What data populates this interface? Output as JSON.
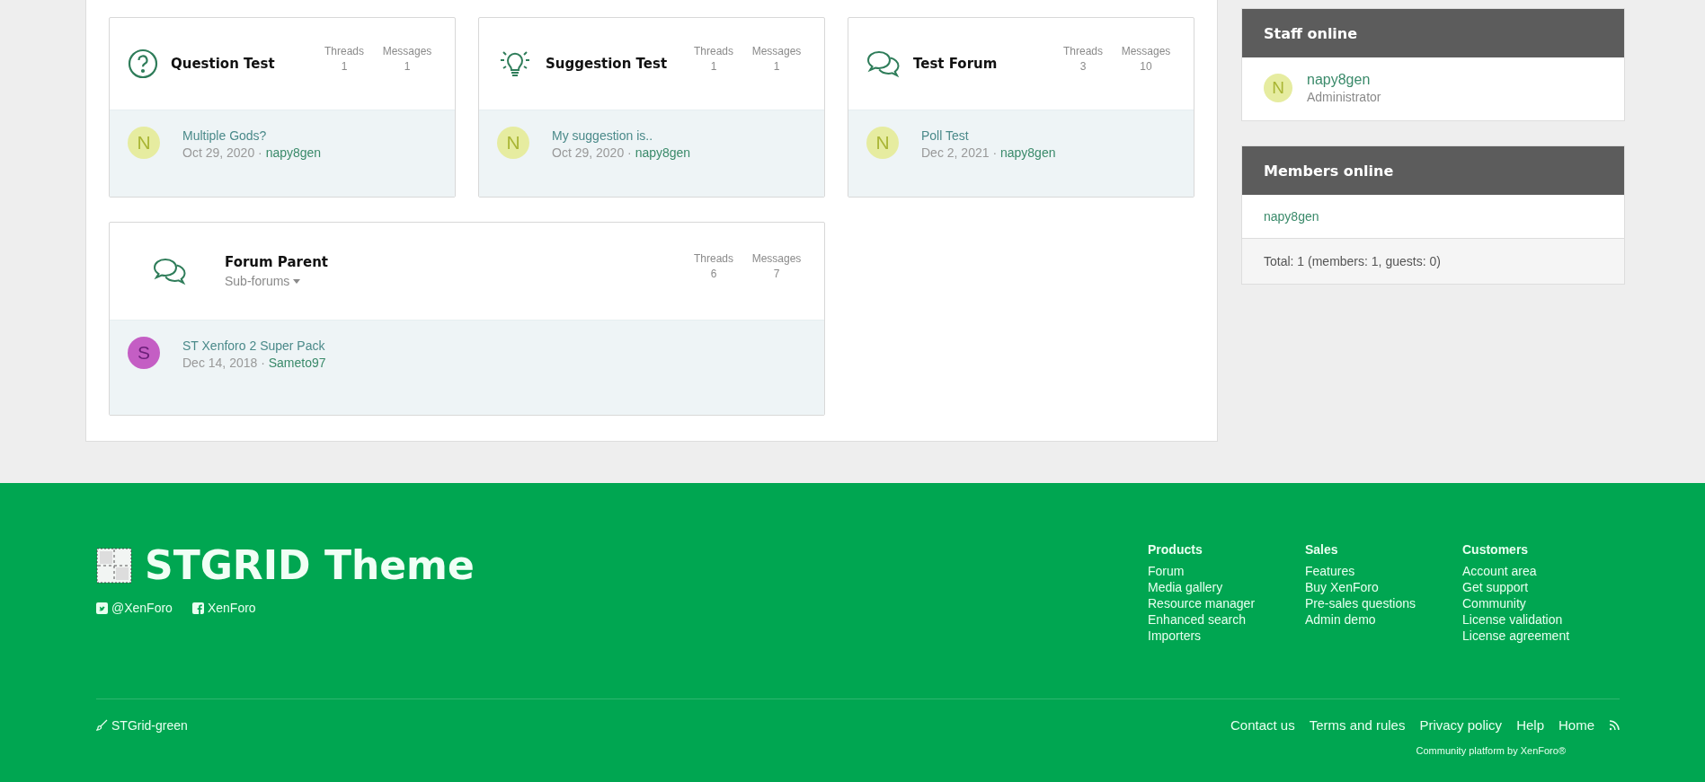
{
  "forums": [
    {
      "kind": "question",
      "title": "Question Test",
      "threads_label": "Threads",
      "threads": "1",
      "messages_label": "Messages",
      "messages": "1",
      "last_post": {
        "avatar_letter": "N",
        "color": "#e6eca0",
        "title": "Multiple Gods?",
        "date": "Oct 29, 2020",
        "separator": "·",
        "author": "napy8gen"
      }
    },
    {
      "kind": "suggestion",
      "title": "Suggestion Test",
      "threads_label": "Threads",
      "threads": "1",
      "messages_label": "Messages",
      "messages": "1",
      "last_post": {
        "avatar_letter": "N",
        "color": "#e6eca0",
        "title": "My suggestion is..",
        "date": "Oct 29, 2020",
        "separator": "·",
        "author": "napy8gen"
      }
    },
    {
      "kind": "discussion",
      "title": "Test Forum",
      "threads_label": "Threads",
      "threads": "3",
      "messages_label": "Messages",
      "messages": "10",
      "last_post": {
        "avatar_letter": "N",
        "color": "#e6eca0",
        "title": "Poll Test",
        "date": "Dec 2, 2021",
        "separator": "·",
        "author": "napy8gen"
      }
    },
    {
      "kind": "discussion",
      "title": "Forum Parent",
      "sub_forums": "Sub-forums",
      "threads_label": "Threads",
      "threads": "6",
      "messages_label": "Messages",
      "messages": "7",
      "last_post": {
        "avatar_letter": "S",
        "color": "#c45ec4",
        "title": "ST Xenforo 2 Super Pack",
        "date": "Dec 14, 2018",
        "separator": "·",
        "author": "Sameto97"
      }
    }
  ],
  "staff_online": {
    "title": "Staff online",
    "members": [
      {
        "avatar_letter": "N",
        "color": "#e6eca0",
        "name": "napy8gen",
        "role": "Administrator"
      }
    ]
  },
  "members_online": {
    "title": "Members online",
    "members": [
      "napy8gen"
    ],
    "total": "Total: 1 (members: 1, guests: 0)"
  },
  "footer": {
    "logo_text": "STGRID Theme",
    "social": [
      {
        "kind": "twitter",
        "label": "@XenForo"
      },
      {
        "kind": "facebook",
        "label": "XenForo"
      }
    ],
    "columns": [
      {
        "heading": "Products",
        "links": [
          "Forum",
          "Media gallery",
          "Resource manager",
          "Enhanced search",
          "Importers"
        ]
      },
      {
        "heading": "Sales",
        "links": [
          "Features",
          "Buy XenForo",
          "Pre-sales questions",
          "Admin demo"
        ]
      },
      {
        "heading": "Customers",
        "links": [
          "Account area",
          "Get support",
          "Community",
          "License validation",
          "License agreement"
        ]
      }
    ],
    "style_chooser": "STGrid-green",
    "links": [
      "Contact us",
      "Terms and rules",
      "Privacy policy",
      "Help",
      "Home"
    ],
    "copyright": "Community platform by XenForo®"
  }
}
